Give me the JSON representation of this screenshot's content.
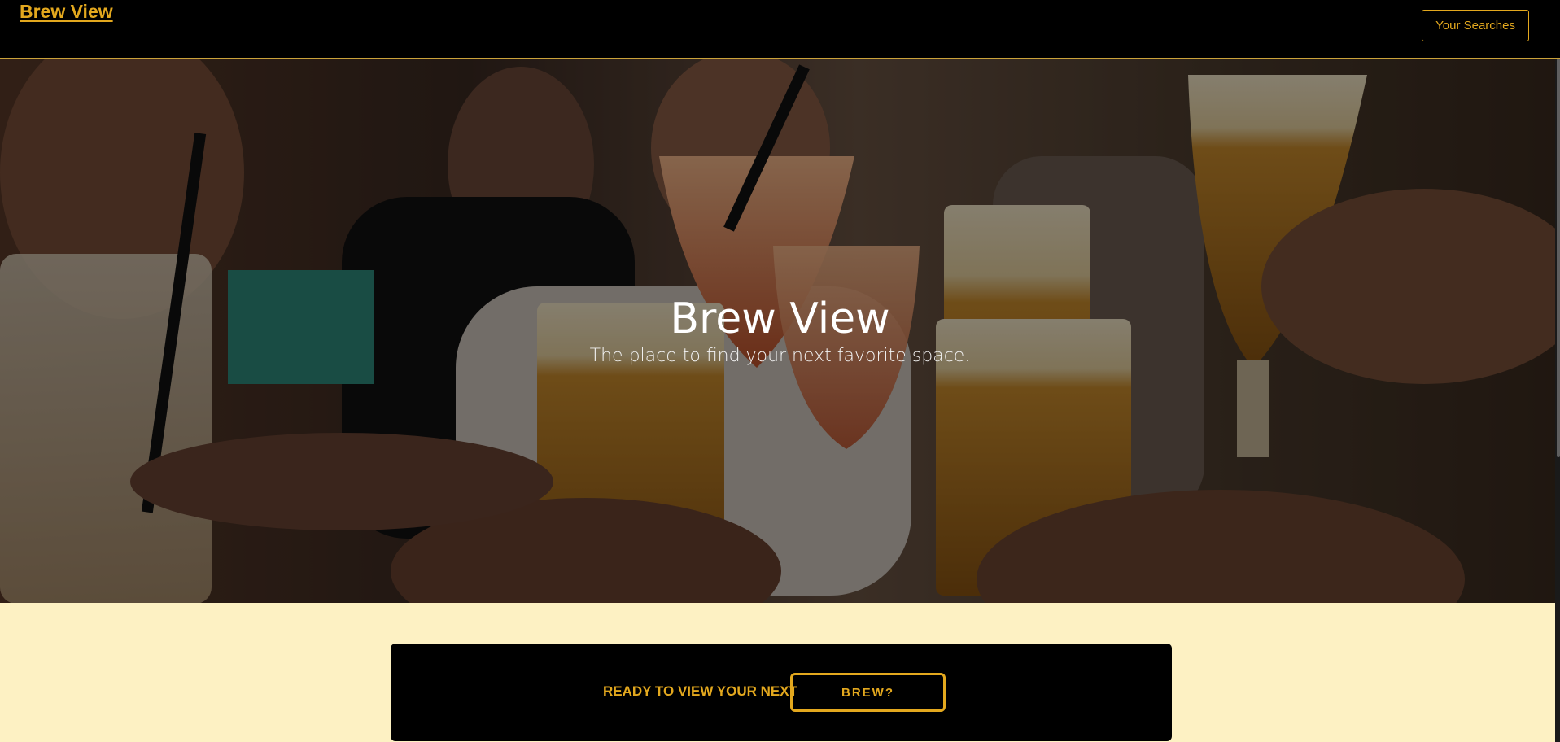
{
  "navbar": {
    "brand": "Brew View",
    "searches_button": "Your Searches"
  },
  "hero": {
    "title": "Brew View",
    "subtitle": "The place to find your next favorite space.",
    "image_description_icon": "people-toasting-beer-photo"
  },
  "cta": {
    "text": "READY TO VIEW YOUR NEXT",
    "button_label": "BREW?"
  },
  "colors": {
    "accent": "#e3a81e",
    "page_background": "#fdf1c3",
    "navbar": "#000000",
    "cta_background": "#000000"
  }
}
